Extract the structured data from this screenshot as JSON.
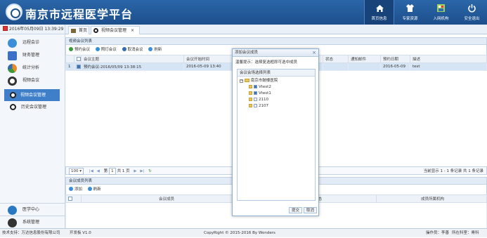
{
  "header": {
    "title": "南京市远程医学平台",
    "nav": [
      {
        "label": "首页信息",
        "icon": "home-icon",
        "active": true
      },
      {
        "label": "专家资源",
        "icon": "shirt-icon",
        "active": false
      },
      {
        "label": "入网机构",
        "icon": "building-icon",
        "active": false
      },
      {
        "label": "安全退出",
        "icon": "power-icon",
        "active": false
      }
    ]
  },
  "sidebar": {
    "date": "2016年05月09日 13:39:29",
    "items": [
      {
        "label": "远程会诊",
        "icon": "consult-icon",
        "color": "#3a8fd8"
      },
      {
        "label": "财务管理",
        "icon": "finance-icon",
        "color": "#3a70c8"
      },
      {
        "label": "统计分析",
        "icon": "chart-icon",
        "color": "#e88a2a"
      },
      {
        "label": "视频会议",
        "icon": "video-icon",
        "color": "#3a3a3a"
      }
    ],
    "subitems": [
      {
        "label": "视频会议管理",
        "icon": "camera-icon",
        "selected": true
      },
      {
        "label": "历史会议管理",
        "icon": "history-icon",
        "selected": false
      }
    ],
    "bottom": [
      {
        "label": "医学中心",
        "icon": "medcenter-icon"
      },
      {
        "label": "系统管理",
        "icon": "gear-icon"
      }
    ]
  },
  "tabs": [
    {
      "label": "首页"
    },
    {
      "label": "视频会议管理",
      "close": "×"
    }
  ],
  "meeting_panel": {
    "title": "视频会议列表",
    "toolbar": [
      "预约会议",
      "取消会议",
      "刷新"
    ],
    "toolbar_mid": "照灯会议",
    "columns": [
      "会议主题",
      "会议开始时间",
      "状态",
      "通知邮件",
      "预约日期",
      "描述"
    ],
    "rows": [
      {
        "index": "1",
        "subject": "预约会议-2016/05/09 13:38:15",
        "start": "2016-05-09 13:40",
        "date": "2016-05-09",
        "desc": "test"
      }
    ]
  },
  "pager": {
    "page_size": "100",
    "page_prefix": "第",
    "page": "1",
    "page_suffix": "共 1 页",
    "summary": "当前显示 1 - 1 条记录 共 1 条记录"
  },
  "member_panel": {
    "title": "会议成员列表",
    "toolbar": [
      "添加",
      "刷新"
    ],
    "columns": [
      "会议成员",
      "成员状态",
      "成员所属机构"
    ]
  },
  "modal": {
    "title": "添加会议成员",
    "close": "×",
    "tip": "温馨提示：选择复选框即可选中成员",
    "tree_title": "会议会场选择列表",
    "root": "南京市鼓楼医院",
    "nodes": [
      {
        "label": "Vtest2",
        "checked": true
      },
      {
        "label": "Vtest1",
        "checked": true
      },
      {
        "label": "2110",
        "checked": false
      },
      {
        "label": "2107",
        "checked": false
      }
    ],
    "submit": "提交",
    "cancel": "取消"
  },
  "footer": {
    "support": "技术支持：万达信息股份有限公司",
    "dev": "开发板 V1.0",
    "copyright": "CopyRight © 2015-2016 By Wonders",
    "operator": "操作员：李善",
    "org": "所在科室：骨科"
  }
}
